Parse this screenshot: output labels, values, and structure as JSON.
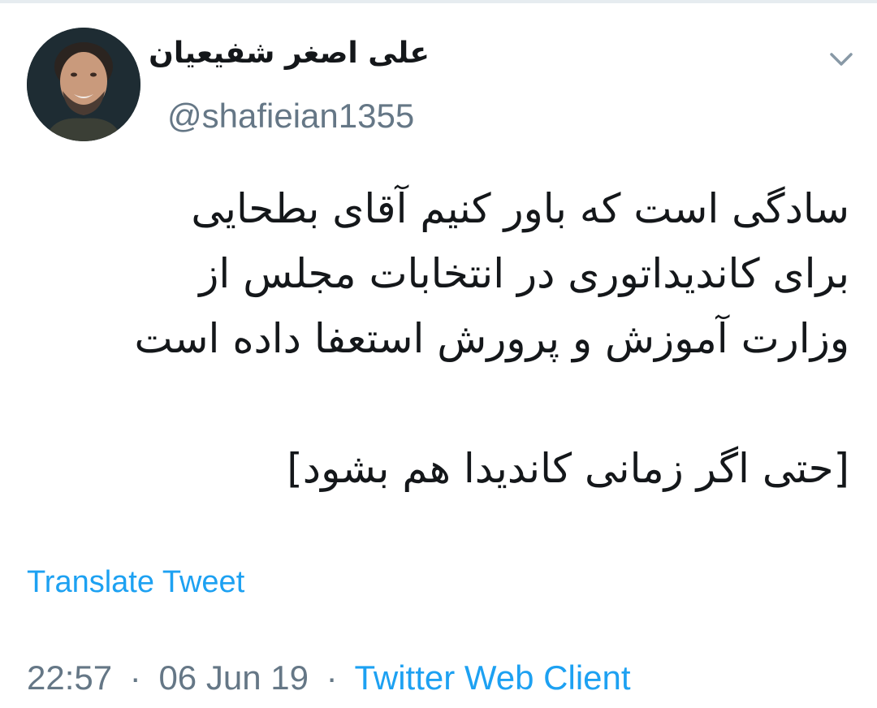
{
  "tweet": {
    "author": {
      "display_name": "علی اصغر شفیعیان",
      "handle": "@shafieian1355",
      "avatar_icon": "user-avatar-photo"
    },
    "menu_icon": "chevron-down-icon",
    "text_lines": [
      "سادگی است که باور کنیم آقای بطحایی",
      "برای کاندیداتوری در انتخابات مجلس از",
      "وزارت آموزش و پرورش استعفا داده است",
      "",
      "[حتی اگر زمانی کاندیدا هم بشود]"
    ],
    "translate_label": "Translate Tweet",
    "time": "22:57",
    "separator": "·",
    "date": "06 Jun 19",
    "source": "Twitter Web Client"
  },
  "colors": {
    "text_primary": "#14171a",
    "text_secondary": "#657786",
    "link": "#1da1f2",
    "divider": "#e6ecf0"
  }
}
